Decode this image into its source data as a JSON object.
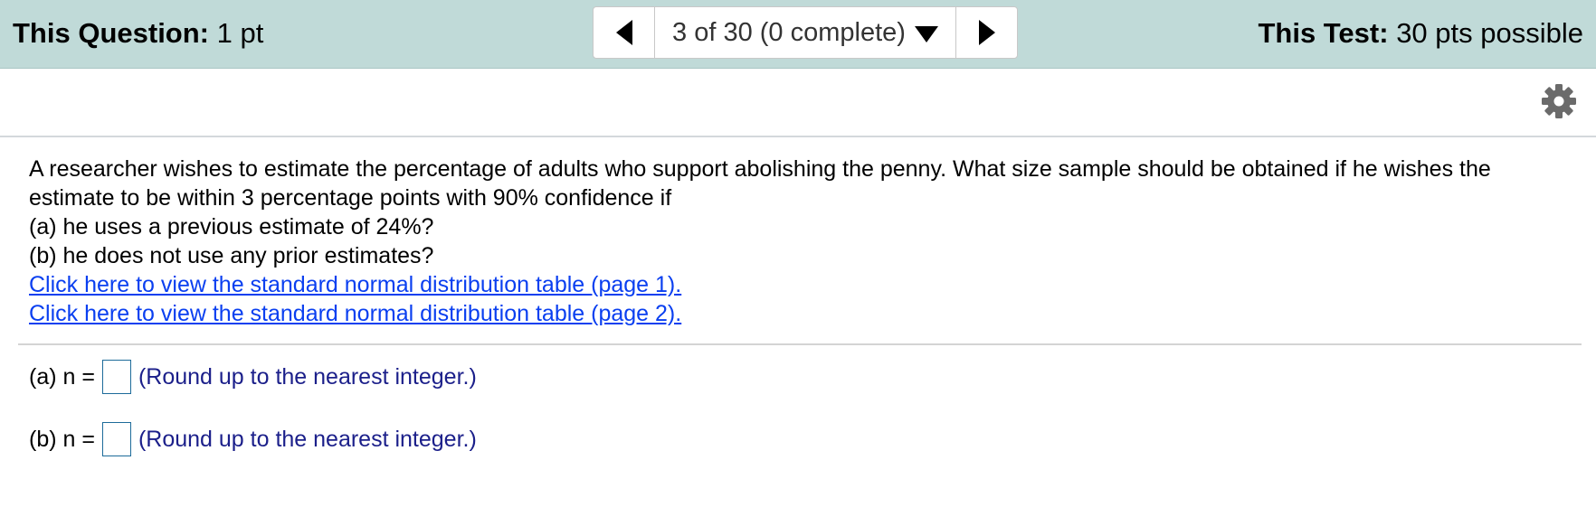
{
  "header": {
    "question_label": "This Question:",
    "question_value": "1 pt",
    "nav_position": "3 of 30 (0 complete)",
    "test_label": "This Test:",
    "test_value": "30 pts possible"
  },
  "icons": {
    "prev": "triangle-left-icon",
    "next": "triangle-right-icon",
    "dropdown": "triangle-down-icon",
    "settings": "gear-icon"
  },
  "colors": {
    "header_bg": "#c0dad8",
    "link": "#0a3ff0",
    "hint_text": "#1b1f8a",
    "input_border": "#1d6b9a"
  },
  "question": {
    "text": "A researcher wishes to estimate the percentage of adults who support abolishing the penny. What size sample should be obtained if he wishes the estimate to be within 3 percentage points with 90% confidence if",
    "part_a": "(a) he uses a previous estimate of 24%?",
    "part_b": "(b) he does not use any prior estimates?",
    "link_1": "Click here to view the standard normal distribution table (page 1).",
    "link_2": "Click here to view the standard normal distribution table (page 2)."
  },
  "answers": {
    "a_label": "(a) n =",
    "a_value": "",
    "a_hint": "(Round up to the nearest integer.)",
    "b_label": "(b) n =",
    "b_value": "",
    "b_hint": "(Round up to the nearest integer.)"
  }
}
